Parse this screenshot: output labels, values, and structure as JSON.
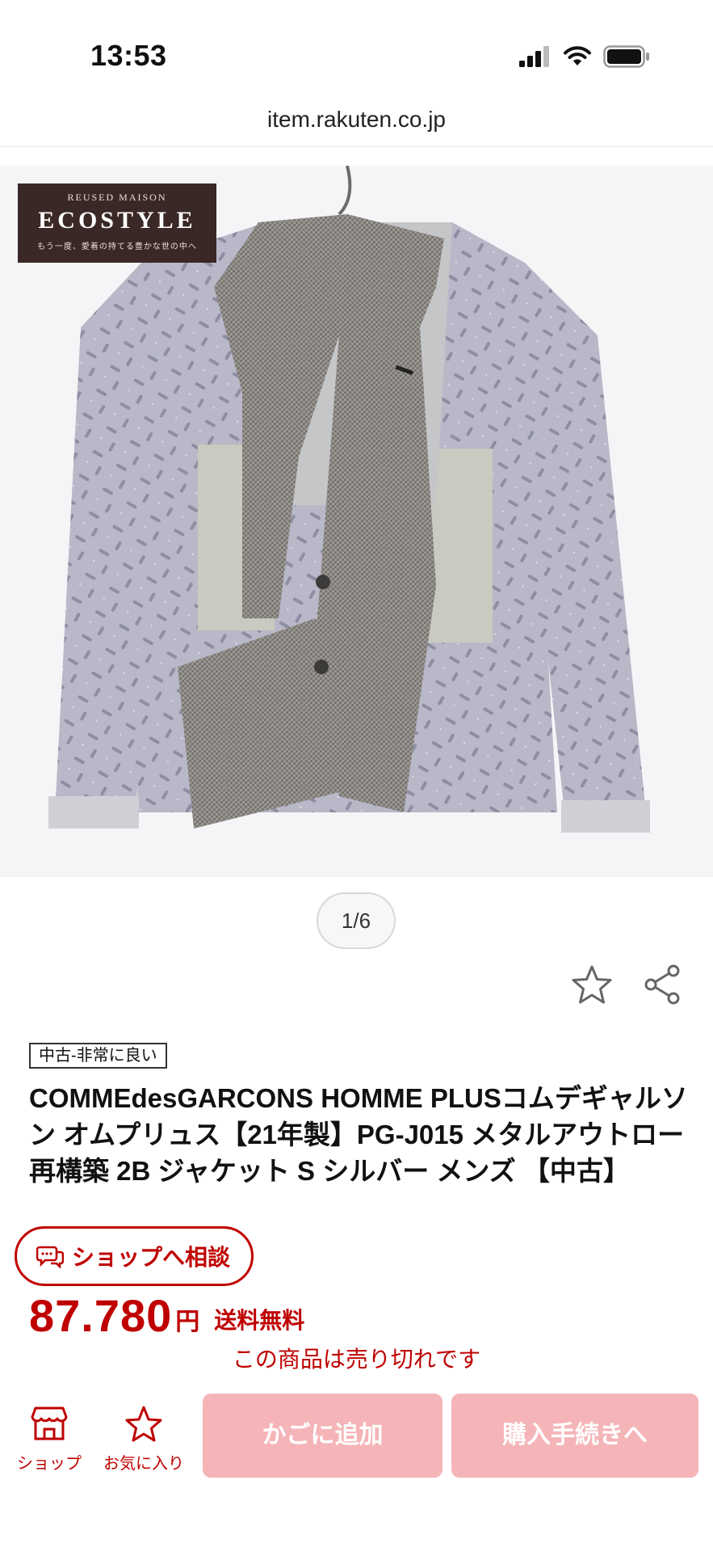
{
  "status_bar": {
    "time": "13:53"
  },
  "browser": {
    "url": "item.rakuten.co.jp"
  },
  "gallery": {
    "logo_line1": "REUSED MAISON",
    "logo_line2": "ECOSTYLE",
    "logo_line3": "もう一度、愛着の持てる豊かな世の中へ",
    "counter": "1/6"
  },
  "product": {
    "condition": "中古-非常に良い",
    "title": "COMMEdesGARCONS HOMME PLUSコムデギャルソン オムプリュス【21年製】PG-J015 メタルアウトロー 再構築 2B ジャケット S シルバー メンズ 【中古】",
    "consult_label": "ショップへ相談",
    "price": "87.780",
    "currency": "円",
    "shipping": "送料無料",
    "soldout_message": "この商品は売り切れです"
  },
  "bottom_nav": {
    "shop_label": "ショップ",
    "favorite_label": "お気に入り",
    "cart_label": "かごに追加",
    "buy_label": "購入手続きへ"
  },
  "colors": {
    "accent": "#bf0000",
    "disabled_button": "#f5b5b8",
    "logo_bg": "#3a2826"
  },
  "icons": [
    "battery-icon",
    "wifi-icon",
    "signal-icon",
    "star-icon",
    "share-icon",
    "chat-icon",
    "shop-icon"
  ]
}
